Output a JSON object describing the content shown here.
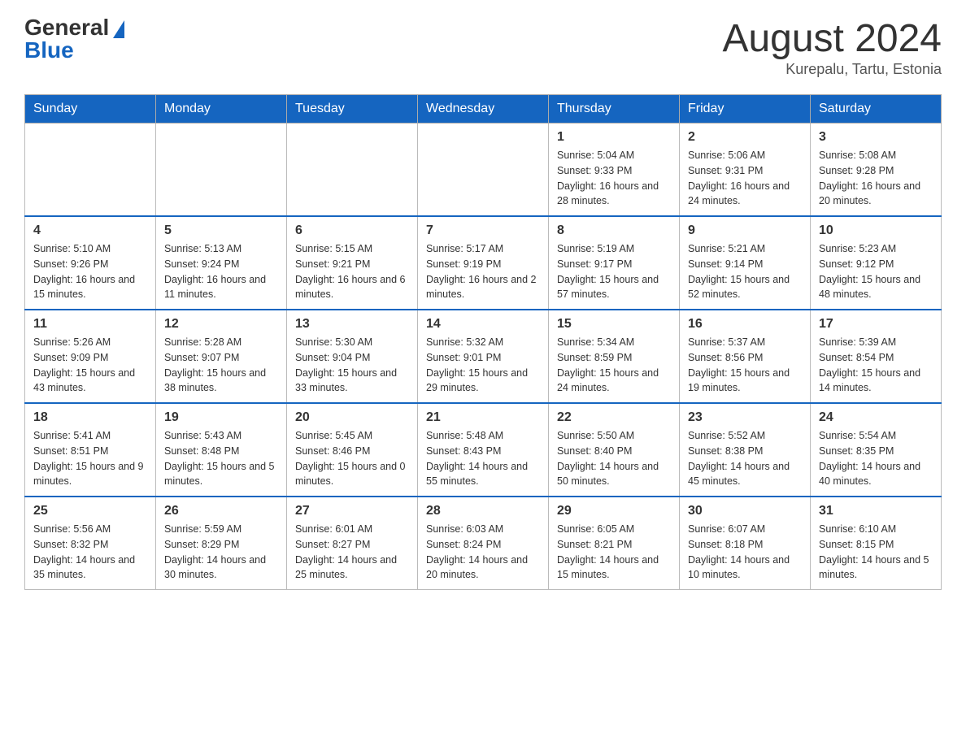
{
  "header": {
    "logo_general": "General",
    "logo_blue": "Blue",
    "month_title": "August 2024",
    "location": "Kurepalu, Tartu, Estonia"
  },
  "days_of_week": [
    "Sunday",
    "Monday",
    "Tuesday",
    "Wednesday",
    "Thursday",
    "Friday",
    "Saturday"
  ],
  "weeks": [
    [
      {
        "day": "",
        "info": ""
      },
      {
        "day": "",
        "info": ""
      },
      {
        "day": "",
        "info": ""
      },
      {
        "day": "",
        "info": ""
      },
      {
        "day": "1",
        "info": "Sunrise: 5:04 AM\nSunset: 9:33 PM\nDaylight: 16 hours and 28 minutes."
      },
      {
        "day": "2",
        "info": "Sunrise: 5:06 AM\nSunset: 9:31 PM\nDaylight: 16 hours and 24 minutes."
      },
      {
        "day": "3",
        "info": "Sunrise: 5:08 AM\nSunset: 9:28 PM\nDaylight: 16 hours and 20 minutes."
      }
    ],
    [
      {
        "day": "4",
        "info": "Sunrise: 5:10 AM\nSunset: 9:26 PM\nDaylight: 16 hours and 15 minutes."
      },
      {
        "day": "5",
        "info": "Sunrise: 5:13 AM\nSunset: 9:24 PM\nDaylight: 16 hours and 11 minutes."
      },
      {
        "day": "6",
        "info": "Sunrise: 5:15 AM\nSunset: 9:21 PM\nDaylight: 16 hours and 6 minutes."
      },
      {
        "day": "7",
        "info": "Sunrise: 5:17 AM\nSunset: 9:19 PM\nDaylight: 16 hours and 2 minutes."
      },
      {
        "day": "8",
        "info": "Sunrise: 5:19 AM\nSunset: 9:17 PM\nDaylight: 15 hours and 57 minutes."
      },
      {
        "day": "9",
        "info": "Sunrise: 5:21 AM\nSunset: 9:14 PM\nDaylight: 15 hours and 52 minutes."
      },
      {
        "day": "10",
        "info": "Sunrise: 5:23 AM\nSunset: 9:12 PM\nDaylight: 15 hours and 48 minutes."
      }
    ],
    [
      {
        "day": "11",
        "info": "Sunrise: 5:26 AM\nSunset: 9:09 PM\nDaylight: 15 hours and 43 minutes."
      },
      {
        "day": "12",
        "info": "Sunrise: 5:28 AM\nSunset: 9:07 PM\nDaylight: 15 hours and 38 minutes."
      },
      {
        "day": "13",
        "info": "Sunrise: 5:30 AM\nSunset: 9:04 PM\nDaylight: 15 hours and 33 minutes."
      },
      {
        "day": "14",
        "info": "Sunrise: 5:32 AM\nSunset: 9:01 PM\nDaylight: 15 hours and 29 minutes."
      },
      {
        "day": "15",
        "info": "Sunrise: 5:34 AM\nSunset: 8:59 PM\nDaylight: 15 hours and 24 minutes."
      },
      {
        "day": "16",
        "info": "Sunrise: 5:37 AM\nSunset: 8:56 PM\nDaylight: 15 hours and 19 minutes."
      },
      {
        "day": "17",
        "info": "Sunrise: 5:39 AM\nSunset: 8:54 PM\nDaylight: 15 hours and 14 minutes."
      }
    ],
    [
      {
        "day": "18",
        "info": "Sunrise: 5:41 AM\nSunset: 8:51 PM\nDaylight: 15 hours and 9 minutes."
      },
      {
        "day": "19",
        "info": "Sunrise: 5:43 AM\nSunset: 8:48 PM\nDaylight: 15 hours and 5 minutes."
      },
      {
        "day": "20",
        "info": "Sunrise: 5:45 AM\nSunset: 8:46 PM\nDaylight: 15 hours and 0 minutes."
      },
      {
        "day": "21",
        "info": "Sunrise: 5:48 AM\nSunset: 8:43 PM\nDaylight: 14 hours and 55 minutes."
      },
      {
        "day": "22",
        "info": "Sunrise: 5:50 AM\nSunset: 8:40 PM\nDaylight: 14 hours and 50 minutes."
      },
      {
        "day": "23",
        "info": "Sunrise: 5:52 AM\nSunset: 8:38 PM\nDaylight: 14 hours and 45 minutes."
      },
      {
        "day": "24",
        "info": "Sunrise: 5:54 AM\nSunset: 8:35 PM\nDaylight: 14 hours and 40 minutes."
      }
    ],
    [
      {
        "day": "25",
        "info": "Sunrise: 5:56 AM\nSunset: 8:32 PM\nDaylight: 14 hours and 35 minutes."
      },
      {
        "day": "26",
        "info": "Sunrise: 5:59 AM\nSunset: 8:29 PM\nDaylight: 14 hours and 30 minutes."
      },
      {
        "day": "27",
        "info": "Sunrise: 6:01 AM\nSunset: 8:27 PM\nDaylight: 14 hours and 25 minutes."
      },
      {
        "day": "28",
        "info": "Sunrise: 6:03 AM\nSunset: 8:24 PM\nDaylight: 14 hours and 20 minutes."
      },
      {
        "day": "29",
        "info": "Sunrise: 6:05 AM\nSunset: 8:21 PM\nDaylight: 14 hours and 15 minutes."
      },
      {
        "day": "30",
        "info": "Sunrise: 6:07 AM\nSunset: 8:18 PM\nDaylight: 14 hours and 10 minutes."
      },
      {
        "day": "31",
        "info": "Sunrise: 6:10 AM\nSunset: 8:15 PM\nDaylight: 14 hours and 5 minutes."
      }
    ]
  ]
}
